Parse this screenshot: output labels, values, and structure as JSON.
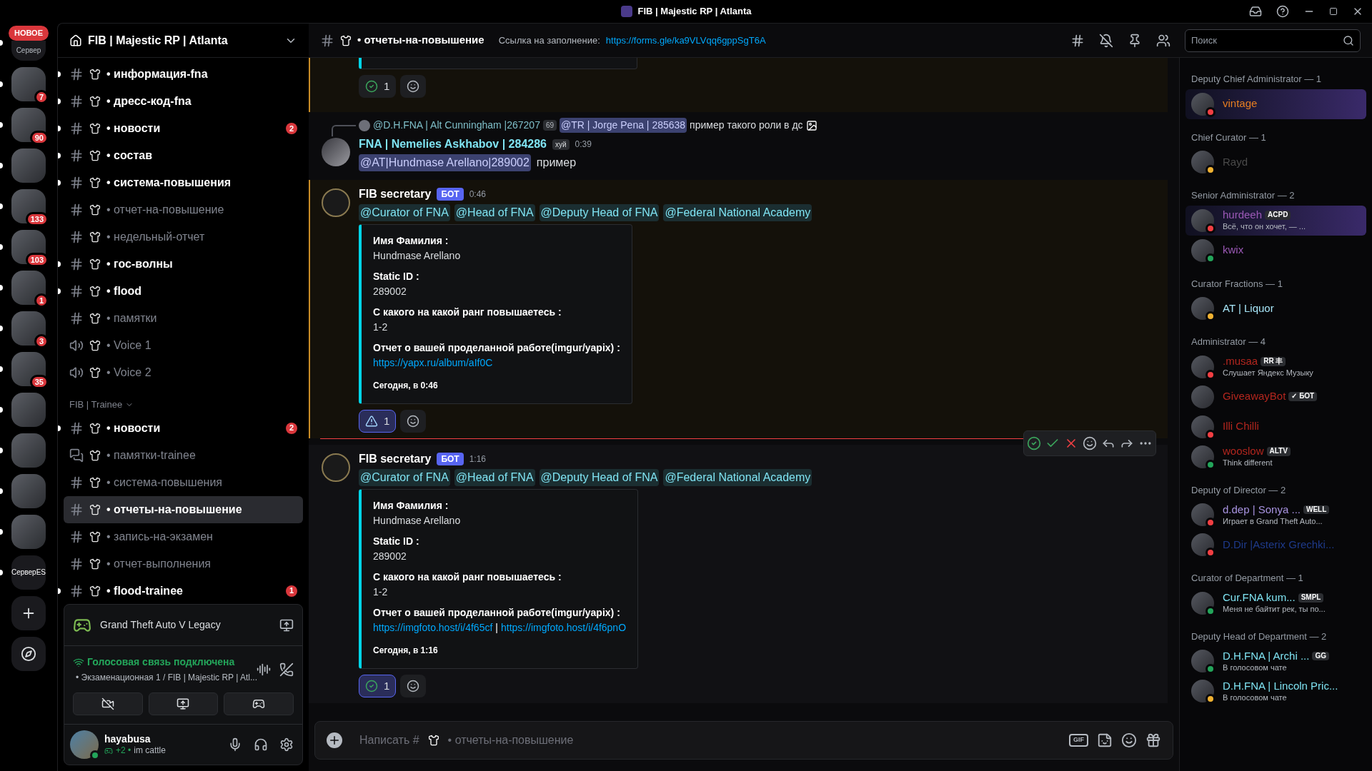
{
  "window": {
    "title": "FIB | Majestic RP | Atlanta"
  },
  "servers": [
    {
      "kind": "folder",
      "label": "НОВОЕ",
      "caption": "Сервер",
      "unread": true
    },
    {
      "kind": "image",
      "unread": true,
      "badge": "7"
    },
    {
      "kind": "image",
      "unread": true,
      "badge": "90"
    },
    {
      "kind": "image",
      "unread": true
    },
    {
      "kind": "image",
      "unread": true,
      "badge": "133"
    },
    {
      "kind": "image",
      "unread": true,
      "badge": "103"
    },
    {
      "kind": "image",
      "unread": true,
      "badge": "1"
    },
    {
      "kind": "image",
      "unread": true,
      "badge": "3"
    },
    {
      "kind": "image",
      "unread": true,
      "badge": "35"
    },
    {
      "kind": "image",
      "unread": true
    },
    {
      "kind": "image",
      "unread": true
    },
    {
      "kind": "image",
      "unread": true
    },
    {
      "kind": "image",
      "unread": true
    },
    {
      "kind": "text",
      "label": "СерверES",
      "unread": true
    },
    {
      "kind": "add",
      "unread": false
    },
    {
      "kind": "explore",
      "unread": false
    }
  ],
  "server_header": {
    "name": "FIB | Majestic RP | Atlanta"
  },
  "channels": [
    {
      "kind": "text",
      "name": "• информация-fna",
      "unread": true,
      "selected": false
    },
    {
      "kind": "text",
      "name": "• дресс-код-fna",
      "unread": true,
      "selected": false
    },
    {
      "kind": "text",
      "name": "• новости",
      "unread": true,
      "selected": false,
      "badge": "2"
    },
    {
      "kind": "text",
      "name": "• состав",
      "unread": true,
      "selected": false
    },
    {
      "kind": "text",
      "name": "• система-повышения",
      "unread": true,
      "selected": false
    },
    {
      "kind": "text",
      "name": "• отчет-на-повышение",
      "unread": false,
      "selected": false
    },
    {
      "kind": "text",
      "name": "• недельный-отчет",
      "unread": false,
      "selected": false
    },
    {
      "kind": "text",
      "name": "• гос-волны",
      "unread": true,
      "selected": false
    },
    {
      "kind": "text",
      "name": "• flood",
      "unread": true,
      "selected": false
    },
    {
      "kind": "text",
      "name": "• памятки",
      "unread": false,
      "selected": false
    },
    {
      "kind": "voice",
      "name": "•  Voice 1",
      "unread": false,
      "selected": false
    },
    {
      "kind": "voice",
      "name": "•  Voice 2",
      "unread": false,
      "selected": false
    },
    {
      "kind": "category",
      "name": "FIB | Trainee",
      "expanded": true,
      "children": [
        {
          "kind": "text",
          "name": "• новости",
          "unread": true,
          "selected": false,
          "badge": "2"
        },
        {
          "kind": "forum",
          "name": "• памятки-trainee",
          "unread": false,
          "selected": false
        },
        {
          "kind": "text",
          "name": "• система-повышения",
          "unread": false,
          "selected": false
        },
        {
          "kind": "text",
          "name": "• отчеты-на-повышение",
          "unread": false,
          "selected": true
        },
        {
          "kind": "text",
          "name": "• запись-на-экзамен",
          "unread": false,
          "selected": false
        },
        {
          "kind": "text",
          "name": "• отчет-выполнения",
          "unread": false,
          "selected": false
        },
        {
          "kind": "text",
          "name": "• flood-trainee",
          "unread": true,
          "selected": false,
          "badge": "1"
        }
      ]
    }
  ],
  "activity": {
    "game": "Grand Theft Auto V Legacy"
  },
  "voice": {
    "status": "Голосовая связь подключена",
    "channel": "• Экзаменационная 1 / FIB | Majestic RP | Atl..."
  },
  "user": {
    "name": "hayabusa",
    "extra": "+2 •",
    "custom_status": "im cattle",
    "presence": {
      "color": "#23a55a"
    }
  },
  "chat_header": {
    "channel": "• отчеты-на-повышение",
    "topic_label": "Ссылка на заполнение:",
    "topic_link": "https://forms.gle/ka9VLVqq6gppSgT6A",
    "search_placeholder": "Поиск"
  },
  "messages": [
    {
      "kind": "partial",
      "mentioned": true,
      "reactions": [
        {
          "kind": "check",
          "count": "1",
          "selected": false
        }
      ]
    },
    {
      "kind": "reply",
      "reply": {
        "author": "@D.H.FNA | Alt Cunningham |267207",
        "tag": "69",
        "mention": "@TR | Jorge Pena | 285638",
        "text": "пример такого роли в дс"
      },
      "author": "FNA | Nemelies Askhabov | 284286",
      "author_tag": "хуй",
      "time": "0:39",
      "mention": "@AT|Hundmase Arellano|289002",
      "text": "пример"
    },
    {
      "kind": "bot",
      "mentioned": true,
      "author": "FIB secretary",
      "badge": "БОТ",
      "time": "0:46",
      "mentions": [
        "@Curator of FNA",
        "@Head of FNA",
        "@Deputy Head of FNA",
        "@Federal National Academy"
      ],
      "embed": {
        "fields": [
          {
            "name": "Имя Фамилия :",
            "value": "Hundmase Arellano"
          },
          {
            "name": "Static ID :",
            "value": "289002"
          },
          {
            "name": "С какого на какой ранг повышаетесь :",
            "value": "1-2"
          }
        ],
        "links_label": "Отчет о вашей проделанной работе(imgur/yapix) :",
        "links": [
          "https://yapx.ru/album/aIf0C"
        ],
        "footer": "Сегодня, в 0:46"
      },
      "reactions": [
        {
          "kind": "warning",
          "count": "1",
          "selected": true
        }
      ]
    },
    {
      "kind": "bot",
      "new_divider": true,
      "hovered": true,
      "author": "FIB secretary",
      "badge": "БОТ",
      "time": "1:16",
      "mentions": [
        "@Curator of FNA",
        "@Head of FNA",
        "@Deputy Head of FNA",
        "@Federal National Academy"
      ],
      "embed": {
        "fields": [
          {
            "name": "Имя Фамилия :",
            "value": "Hundmase Arellano"
          },
          {
            "name": "Static ID :",
            "value": "289002"
          },
          {
            "name": "С какого на какой ранг повышаетесь :",
            "value": "1-2"
          }
        ],
        "links_label": "Отчет о вашей проделанной работе(imgur/yapix) :",
        "links": [
          "https://imgfoto.host/i/4f65cf",
          "https://imgfoto.host/i/4f6pnO"
        ],
        "link_separator": "|",
        "footer": "Сегодня, в 1:16"
      },
      "reactions": [
        {
          "kind": "check",
          "count": "1",
          "selected": true
        }
      ]
    }
  ],
  "composer": {
    "prefix": "Написать #",
    "channel": "• отчеты-на-повышение",
    "gif": "GIF"
  },
  "member_groups": [
    {
      "title": "Deputy Chief Administrator — 1",
      "members": [
        {
          "name": "vintage",
          "color": "#e67e22",
          "presence": {
            "color": "#f23f43"
          },
          "banner": true
        }
      ]
    },
    {
      "title": "Chief Curator — 1",
      "members": [
        {
          "name": "Rayd",
          "color": "#4a4a4a",
          "presence": {
            "color": "#f0b232"
          },
          "banner": false
        }
      ]
    },
    {
      "title": "Senior Administrator — 2",
      "members": [
        {
          "name": "hurdeeh",
          "color": "#9b59b6",
          "presence": {
            "color": "#f23f43"
          },
          "banner": true,
          "tag": "ACPD",
          "subtitle": "Всё, что он хочет, — ..."
        },
        {
          "name": "kwix",
          "color": "#9b59b6",
          "presence": {
            "color": "#23a55a"
          },
          "banner": false
        }
      ]
    },
    {
      "title": "Curator Fractions — 1",
      "members": [
        {
          "name": "AT | Liquor",
          "color": "#a6e4f7",
          "presence": {
            "color": "#f0b232"
          },
          "banner": false
        }
      ]
    },
    {
      "title": "Administrator — 4",
      "members": [
        {
          "name": ".musaa",
          "color": "#b3261e",
          "presence": {
            "color": "#f23f43"
          },
          "banner": false,
          "tag": "RR 丰",
          "subtitle": "Слушает Яндекс Музыку"
        },
        {
          "name": "GiveawayBot",
          "color": "#b3261e",
          "banner": false,
          "tag": "✓ БОТ"
        },
        {
          "name": "Illi Chilli",
          "color": "#b3261e",
          "presence": {
            "color": "#f23f43"
          },
          "banner": false
        },
        {
          "name": "wooslow",
          "color": "#b3261e",
          "presence": {
            "color": "#23a55a"
          },
          "banner": false,
          "tag": "ALTV",
          "subtitle": "Think different"
        }
      ]
    },
    {
      "title": "Deputy of Director — 2",
      "members": [
        {
          "name": "d.dep | Sonya ...",
          "color": "#a893e0",
          "presence": {
            "color": "#f23f43"
          },
          "banner": false,
          "tag": "WELL",
          "subtitle": "Играет в Grand Theft Auto..."
        },
        {
          "name": "D.Dir |Asterix Grechki...",
          "color": "#1e3a8a",
          "presence": {
            "color": "#f23f43"
          },
          "banner": false
        }
      ]
    },
    {
      "title": "Curator of Department — 1",
      "members": [
        {
          "name": "Cur.FNA kum...",
          "color": "#7fe3f2",
          "presence": {
            "color": "#23a55a"
          },
          "banner": false,
          "tag": "SMPL",
          "subtitle": "Меня не байтит рек, ты по..."
        }
      ]
    },
    {
      "title": "Deputy Head of Department — 2",
      "members": [
        {
          "name": "D.H.FNA | Archi ...",
          "color": "#7fe3f2",
          "presence": {
            "color": "#23a55a"
          },
          "banner": false,
          "tag": "GG",
          "subtitle": "В голосовом чате"
        },
        {
          "name": "D.H.FNA | Lincoln Pric...",
          "color": "#7fe3f2",
          "presence": {
            "color": "#f0b232"
          },
          "banner": false,
          "subtitle": "В голосовом чате"
        }
      ]
    }
  ]
}
